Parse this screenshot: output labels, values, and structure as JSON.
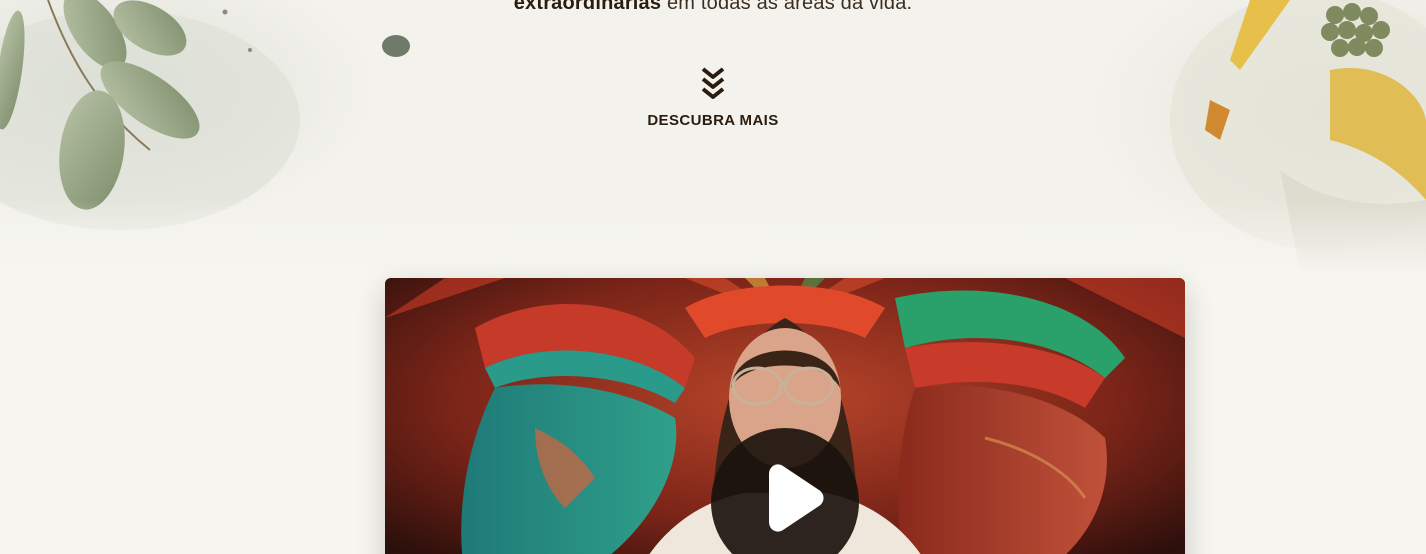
{
  "hero": {
    "tagline_bold": "extraordinárias",
    "tagline_rest": " em todas as áreas da vida.",
    "discover_label": "DESCUBRA MAIS",
    "discover_icon": "chevrons-down-icon"
  },
  "video": {
    "play_icon": "play-icon"
  },
  "colors": {
    "background": "#f6f5f0",
    "text_dark": "#2a1d10",
    "play_button": "#1c140e"
  }
}
